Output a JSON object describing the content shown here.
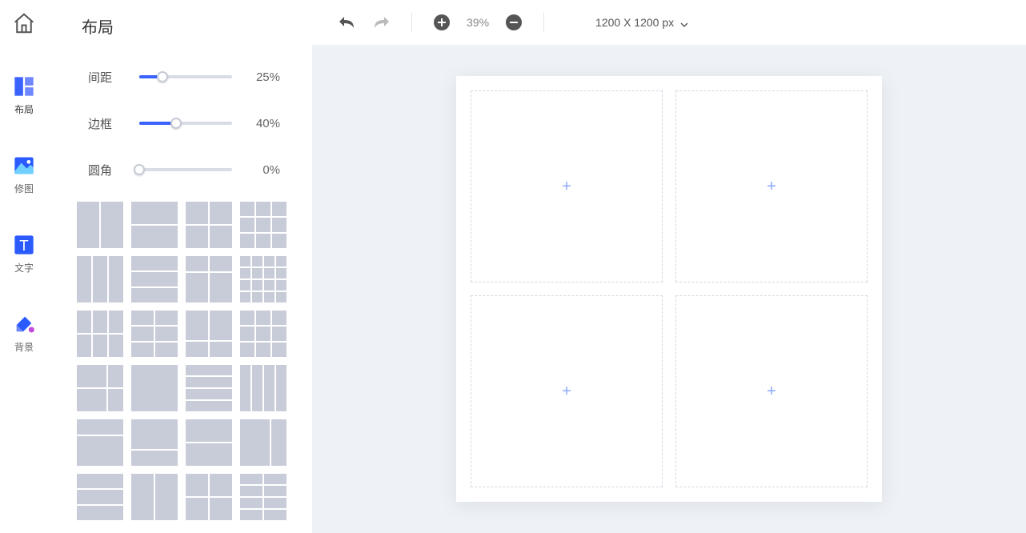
{
  "nav": {
    "layout_label": "布局",
    "image_label": "修图",
    "text_label": "文字",
    "bg_label": "背景"
  },
  "panel": {
    "title": "布局",
    "sliders": {
      "spacing": {
        "label": "间距",
        "value": "25%",
        "pct": 25
      },
      "border": {
        "label": "边框",
        "value": "40%",
        "pct": 40
      },
      "radius": {
        "label": "圆角",
        "value": "0%",
        "pct": 0
      }
    }
  },
  "toolbar": {
    "zoom": "39%",
    "canvas_size": "1200 X 1200 px"
  },
  "canvas": {
    "slot_glyph": "+"
  }
}
